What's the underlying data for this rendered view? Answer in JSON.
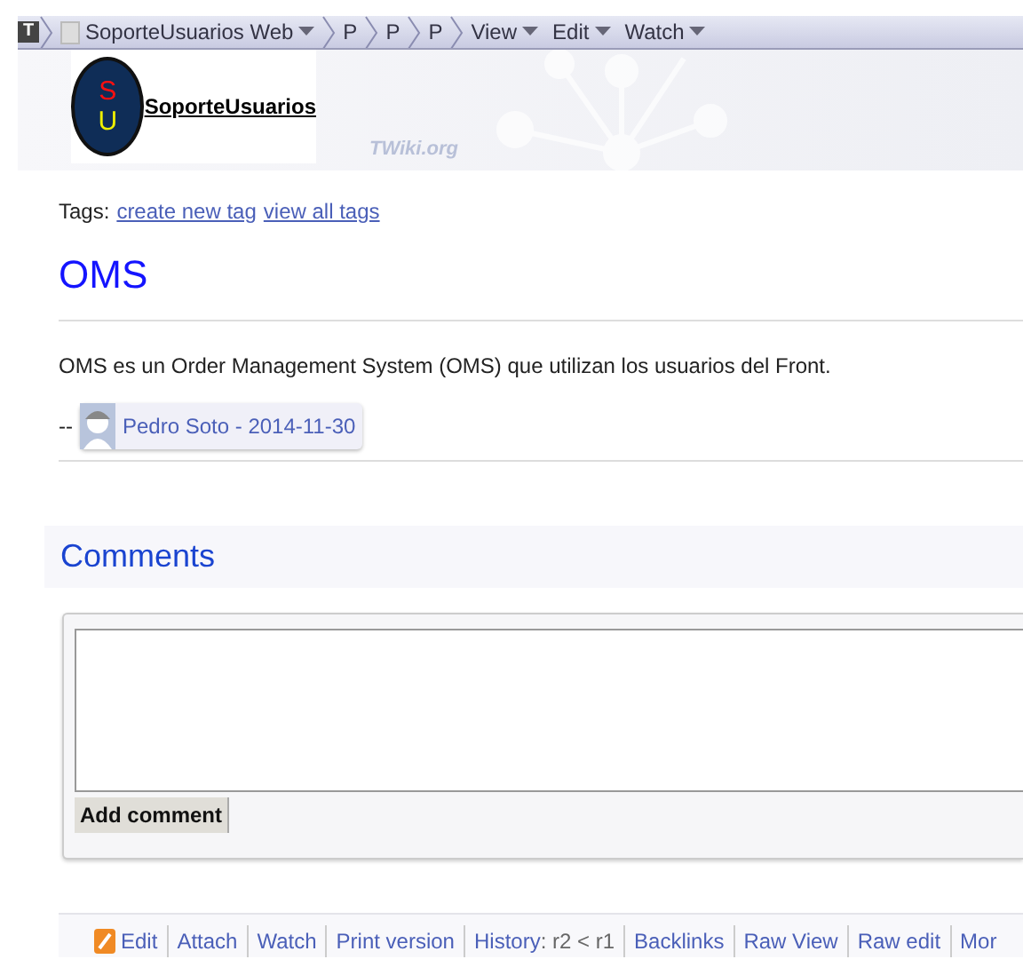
{
  "toolbar": {
    "items": [
      {
        "kind": "logo",
        "label": "T"
      },
      {
        "kind": "web",
        "label": "SoporteUsuarios Web",
        "dropdown": true
      },
      {
        "kind": "crumb",
        "label": "P",
        "dropdown": false
      },
      {
        "kind": "crumb",
        "label": "P",
        "dropdown": false
      },
      {
        "kind": "crumb",
        "label": "P",
        "dropdown": false
      },
      {
        "kind": "menu",
        "label": "View",
        "dropdown": true
      },
      {
        "kind": "menu",
        "label": "Edit",
        "dropdown": true
      },
      {
        "kind": "menu",
        "label": "Watch",
        "dropdown": true
      }
    ]
  },
  "header": {
    "logo_letters": [
      "S",
      "U"
    ],
    "logo_link": "SoporteUsuarios",
    "watermark": "TWiki.org"
  },
  "tags": {
    "label": "Tags:",
    "links": [
      "create new tag",
      "view all tags"
    ]
  },
  "topic": {
    "title": "OMS",
    "body": "OMS es un Order Management System (OMS) que utilizan los usuarios del Front.",
    "signature_prefix": "--",
    "signature": "Pedro Soto - 2014-11-30"
  },
  "comments": {
    "title": "Comments",
    "button": "Add comment"
  },
  "footer": {
    "items": [
      {
        "kind": "link",
        "text": "Edit",
        "icon": true
      },
      {
        "kind": "link",
        "text": "Attach",
        "icon": false
      },
      {
        "kind": "link",
        "text": "Watch",
        "icon": false
      },
      {
        "kind": "link",
        "text": "Print version",
        "icon": false
      },
      {
        "kind": "history",
        "text": "History",
        "rest": ": r2 < r1",
        "icon": false
      },
      {
        "kind": "link",
        "text": "Backlinks",
        "icon": false
      },
      {
        "kind": "link",
        "text": "Raw View",
        "icon": false
      },
      {
        "kind": "link",
        "text": "Raw edit",
        "icon": false
      },
      {
        "kind": "link",
        "text": "Mor",
        "icon": false
      }
    ]
  }
}
